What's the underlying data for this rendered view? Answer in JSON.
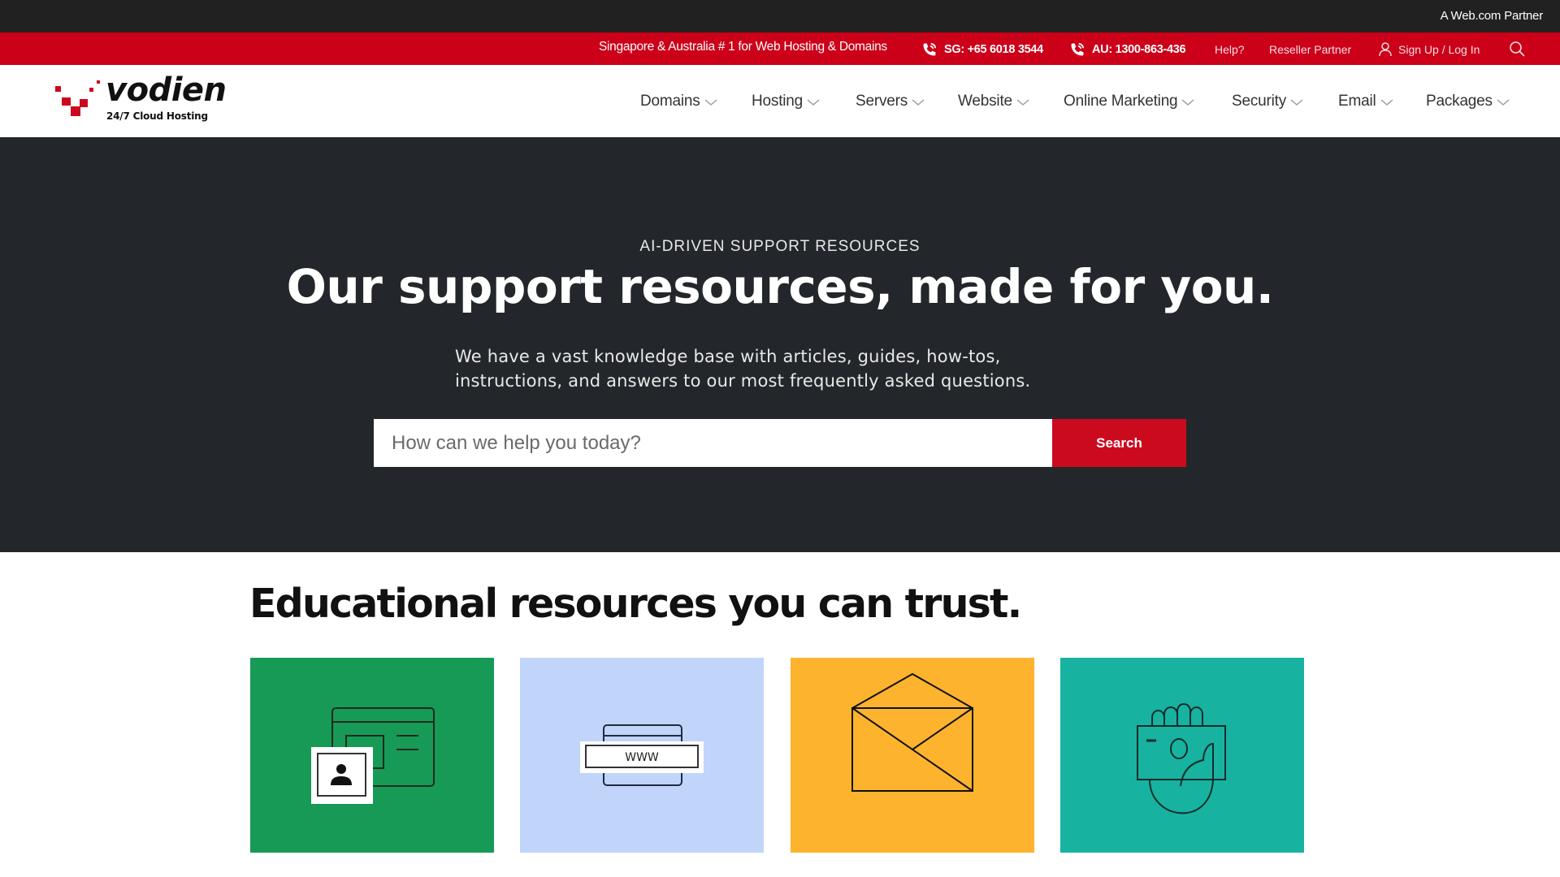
{
  "partner_bar": {
    "text": "A Web.com Partner"
  },
  "utility_bar": {
    "tagline": "Singapore & Australia # 1 for Web Hosting & Domains",
    "phones": [
      {
        "label": "SG: +65 6018 3544",
        "icon": "phone-icon"
      },
      {
        "label": "AU: 1300-863-436",
        "icon": "phone-icon"
      }
    ],
    "help_label": "Help?",
    "reseller_label": "Reseller Partner",
    "signup_label": "Sign Up / Log In",
    "search_icon": "search-icon"
  },
  "header": {
    "logo": {
      "wordmark": "vodien",
      "tagline": "24/7 Cloud Hosting"
    },
    "nav": [
      {
        "label": "Domains"
      },
      {
        "label": "Hosting"
      },
      {
        "label": "Servers"
      },
      {
        "label": "Website"
      },
      {
        "label": "Online Marketing"
      },
      {
        "label": "Security"
      },
      {
        "label": "Email"
      },
      {
        "label": "Packages"
      }
    ]
  },
  "hero": {
    "eyebrow": "AI-DRIVEN SUPPORT RESOURCES",
    "headline": "Our support resources, made for you.",
    "description_line1": "We have a vast knowledge base with articles, guides, how-tos,",
    "description_line2": "instructions, and answers to our most frequently asked questions.",
    "search": {
      "placeholder": "How can we help you today?",
      "value": "",
      "button_label": "Search"
    }
  },
  "education": {
    "title": "Educational resources you can trust.",
    "cards": [
      {
        "icon": "website-profile-icon",
        "color": "#169a56"
      },
      {
        "icon": "domain-www-icon",
        "color": "#c1d4fa",
        "icon_text": "WWW"
      },
      {
        "icon": "envelope-icon",
        "color": "#fdb32e"
      },
      {
        "icon": "hand-money-icon",
        "color": "#18b2a1"
      }
    ]
  },
  "colors": {
    "brand_red": "#cc0019",
    "partner_bar": "#212121",
    "hero_bg": "#23272b"
  }
}
